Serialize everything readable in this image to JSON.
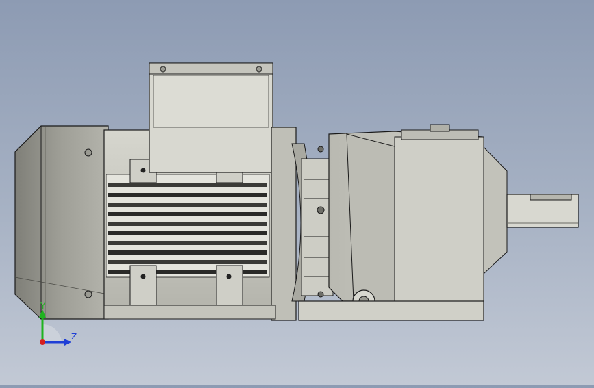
{
  "viewport": {
    "background_top": "#8d9bb3",
    "background_bottom": "#c2c9d5",
    "model": {
      "parts": [
        "fan-cover",
        "motor-housing",
        "terminal-box",
        "flange-adapter",
        "gearbox",
        "output-shaft",
        "foot-mount"
      ],
      "body_color": "#c9c9c0",
      "shadow_color": "#8e8e86",
      "edge_color": "#1a1a1a"
    }
  },
  "triad": {
    "y_label": "Y",
    "z_label": "Z",
    "y_color": "#1fb31f",
    "z_color": "#1f3fd6",
    "x_color": "#d61f1f"
  }
}
